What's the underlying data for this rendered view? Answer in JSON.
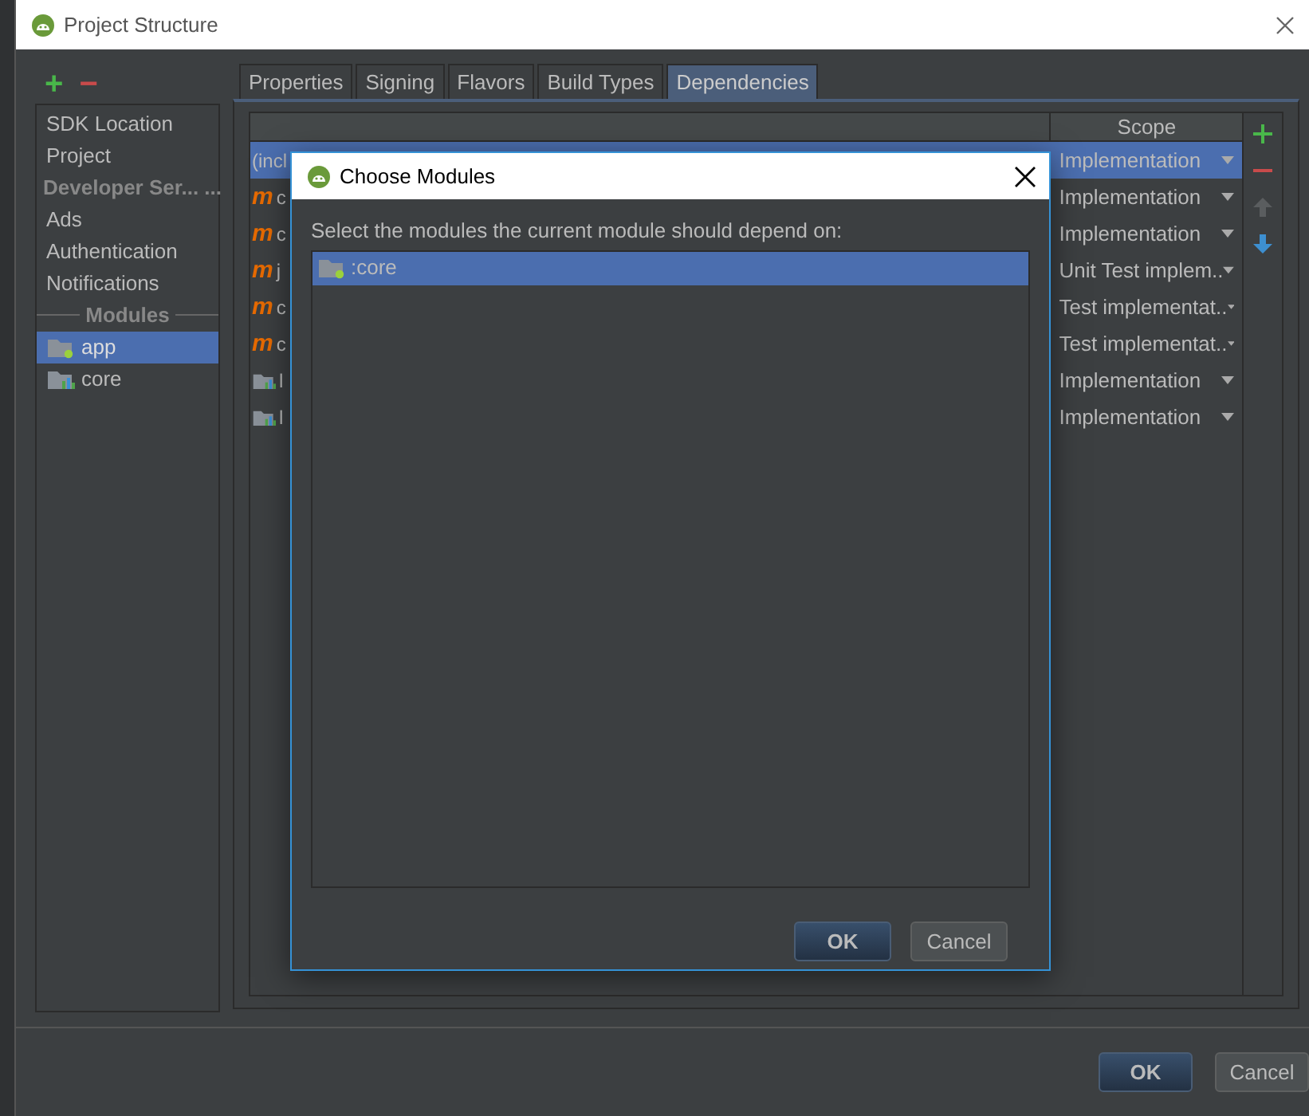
{
  "window": {
    "title": "Project Structure"
  },
  "sidebar": {
    "actions": [
      {
        "kind": "add",
        "label": "+"
      },
      {
        "kind": "remove",
        "label": "−"
      }
    ],
    "items": [
      {
        "kind": "item",
        "label": "SDK Location",
        "selected": false
      },
      {
        "kind": "item",
        "label": "Project",
        "selected": false
      },
      {
        "kind": "header",
        "label": "Developer Ser... ..."
      },
      {
        "kind": "item",
        "label": "Ads",
        "selected": false
      },
      {
        "kind": "item",
        "label": "Authentication",
        "selected": false
      },
      {
        "kind": "item",
        "label": "Notifications",
        "selected": false
      },
      {
        "kind": "section",
        "label": "Modules"
      },
      {
        "kind": "app-module",
        "label": "app",
        "selected": true
      },
      {
        "kind": "lib-module",
        "label": "core",
        "selected": false
      }
    ]
  },
  "tabs": [
    {
      "label": "Properties",
      "selected": false
    },
    {
      "label": "Signing",
      "selected": false
    },
    {
      "label": "Flavors",
      "selected": false
    },
    {
      "label": "Build Types",
      "selected": false
    },
    {
      "label": "Dependencies",
      "selected": true
    }
  ],
  "table": {
    "scope_header": "Scope",
    "rows": [
      {
        "kind": "file",
        "name": "(incl",
        "scope": "Implementation",
        "selected": true
      },
      {
        "kind": "maven",
        "mark": "m",
        "name": "c",
        "scope": "Implementation",
        "selected": false
      },
      {
        "kind": "maven",
        "mark": "m",
        "name": "c",
        "scope": "Implementation",
        "selected": false
      },
      {
        "kind": "maven",
        "mark": "m",
        "name": "j",
        "scope": "Unit Test implem..",
        "selected": false
      },
      {
        "kind": "maven",
        "mark": "m",
        "name": "c",
        "scope": "Test implementat..",
        "selected": false
      },
      {
        "kind": "maven",
        "mark": "m",
        "name": "c",
        "scope": "Test implementat..",
        "selected": false
      },
      {
        "kind": "library",
        "name": "l",
        "scope": "Implementation",
        "selected": false
      },
      {
        "kind": "library",
        "name": "l",
        "scope": "Implementation",
        "selected": false
      }
    ]
  },
  "toolbar": [
    {
      "kind": "add",
      "disabled": false
    },
    {
      "kind": "remove",
      "disabled": false
    },
    {
      "kind": "up",
      "disabled": true
    },
    {
      "kind": "down",
      "disabled": false
    }
  ],
  "dialog": {
    "title": "Choose Modules",
    "prompt": "Select the modules the current module should depend on:",
    "modules": [
      {
        "label": ":core",
        "selected": true
      }
    ],
    "buttons": [
      {
        "kind": "primary",
        "label": "OK"
      },
      {
        "kind": "secondary",
        "label": "Cancel"
      }
    ]
  },
  "footer": {
    "buttons": [
      {
        "kind": "primary",
        "label": "OK"
      },
      {
        "kind": "secondary",
        "label": "Cancel"
      }
    ]
  }
}
